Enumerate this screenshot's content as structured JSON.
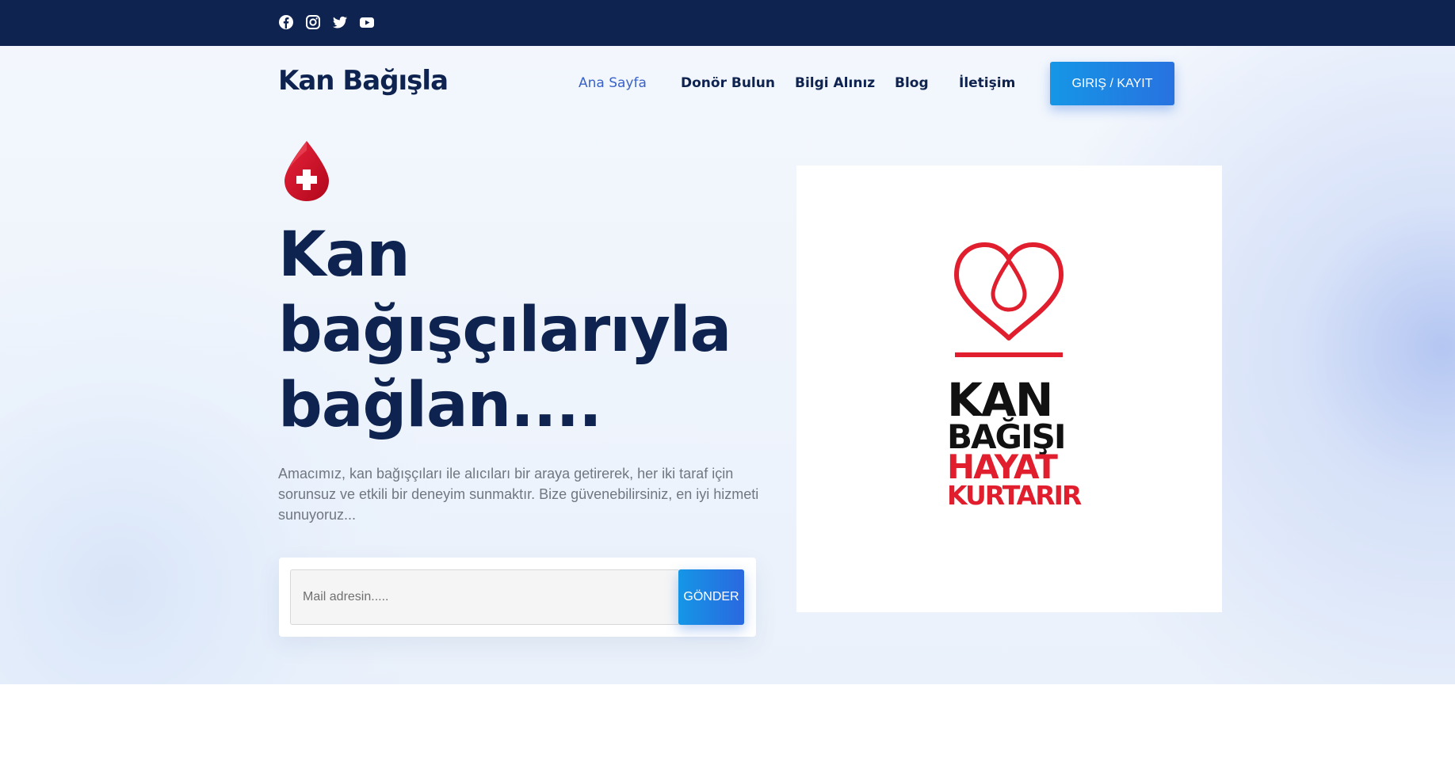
{
  "topbar": {
    "social_icons": [
      "facebook-icon",
      "instagram-icon",
      "twitter-icon",
      "youtube-icon"
    ]
  },
  "header": {
    "logo": "Kan Bağışla",
    "nav": [
      {
        "label": "Ana Sayfa",
        "active": true
      },
      {
        "label": "Donör Bulun",
        "active": false
      },
      {
        "label": "Bilgi Alınız",
        "active": false
      },
      {
        "label": "Blog",
        "active": false
      },
      {
        "label": "İletişim",
        "active": false
      }
    ],
    "login_button": "GIRIŞ / KAYIT"
  },
  "hero": {
    "icon": "blood-drop-cross-icon",
    "headline": "Kan bağışçılarıyla bağlan....",
    "description": "Amacımız, kan bağışçıları ile alıcıları bir araya getirerek, her iki taraf için sorunsuz ve etkili bir deneyim sunmaktır. Bize güvenebilirsiniz, en iyi hizmeti sunuyoruz...",
    "form": {
      "email_placeholder": "Mail adresin.....",
      "submit_label": "GÖNDER"
    }
  },
  "promo": {
    "icon": "heart-drop-logo",
    "lines": [
      "KAN",
      "BAĞIŞI",
      "HAYAT",
      "KURTARIR"
    ]
  },
  "colors": {
    "navy": "#0e2350",
    "accent_blue": "#2872e0",
    "active_link": "#3a63c9",
    "red": "#e01e2d"
  }
}
